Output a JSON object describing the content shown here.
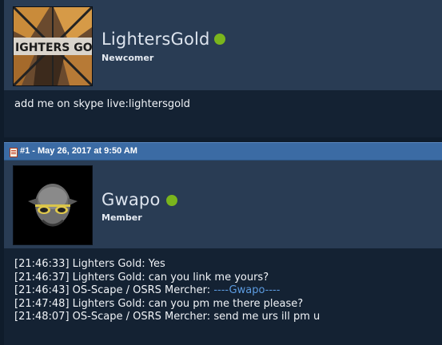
{
  "post_prev": {
    "username": "LightersGold",
    "rank": "Newcomer",
    "avatar_text": "IGHTERS GOL",
    "message": "add me on skype live:lightersgold",
    "online_color": "#7ab51d"
  },
  "post_bar": {
    "label": "#1 - May 26, 2017 at 9:50 AM",
    "icon": "post-icon"
  },
  "post_current": {
    "username": "Gwapo",
    "rank": "Member",
    "online_color": "#7ab51d",
    "lines": [
      {
        "time": "[21:46:33]",
        "sender": "Lighters Gold:",
        "text": "Yes"
      },
      {
        "time": "[21:46:37]",
        "sender": "Lighters Gold:",
        "text": "can you link me yours?"
      },
      {
        "time": "[21:46:43]",
        "sender": "OS-Scape / OSRS Mercher:",
        "text": "----Gwapo----"
      },
      {
        "time": "[21:47:48]",
        "sender": "Lighters Gold:",
        "text": "can you pm me there please?"
      },
      {
        "time": "[21:48:07]",
        "sender": "OS-Scape / OSRS Mercher:",
        "text": "send me urs ill pm u"
      }
    ]
  }
}
